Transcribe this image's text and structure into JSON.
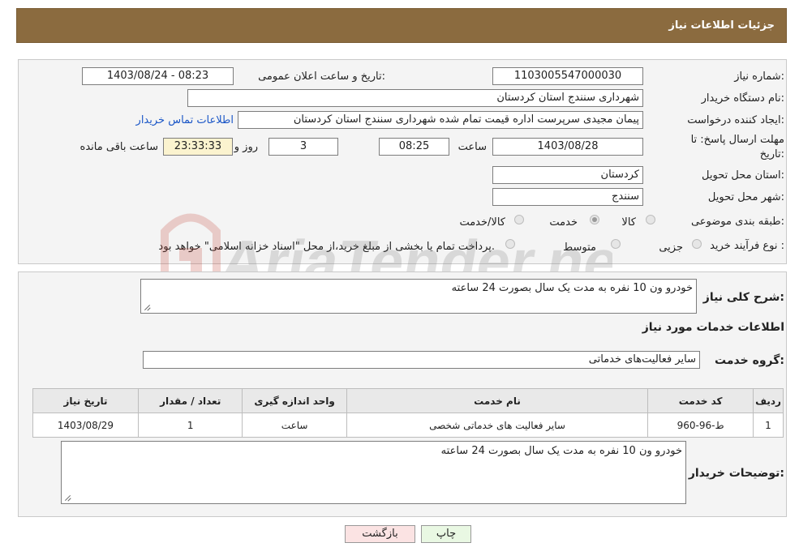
{
  "header": {
    "title": "جزئیات اطلاعات نیاز"
  },
  "form": {
    "need_number_label": "شماره نیاز:",
    "need_number": "1103005547000030",
    "announce_label": "تاریخ و ساعت اعلان عمومی:",
    "announce_value": "1403/08/24 - 08:23",
    "buyer_org_label": "نام دستگاه خریدار:",
    "buyer_org": "شهرداری سنندج استان کردستان",
    "creator_label": "ایجاد کننده درخواست:",
    "creator": "پیمان مجیدی سرپرست اداره قیمت تمام شده شهرداری سنندج استان کردستان",
    "contact_link": "اطلاعات تماس خریدار",
    "deadline_label_1": "مهلت ارسال پاسخ: تا",
    "deadline_label_2": "تاریخ:",
    "deadline_date": "1403/08/28",
    "time_label": "ساعت",
    "deadline_time": "08:25",
    "days": "3",
    "days_label": "روز و",
    "remaining": "23:33:33",
    "remaining_label": "ساعت باقی مانده",
    "province_label": "استان محل تحویل:",
    "province": "کردستان",
    "city_label": "شهر محل تحویل:",
    "city": "سنندج",
    "category_label": "طبقه بندی موضوعی:",
    "category_options": [
      "کالا",
      "خدمت",
      "کالا/خدمت"
    ],
    "category_selected": "خدمت",
    "process_label": "نوع فرآیند خرید :",
    "process_options": [
      "جزیی",
      "متوسط",
      ""
    ],
    "process_note": "پرداخت تمام یا بخشی از مبلغ خرید،از محل \"اسناد خزانه اسلامی\" خواهد بود."
  },
  "details": {
    "summary_label": "شرح کلی نیاز:",
    "summary": "خودرو ون 10 نفره به مدت یک سال بصورت 24 ساعته",
    "services_title": "اطلاعات خدمات مورد نیاز",
    "service_group_label": "گروه خدمت:",
    "service_group": "سایر فعالیت‌های خدماتی",
    "table": {
      "headers": [
        "ردیف",
        "کد خدمت",
        "نام خدمت",
        "واحد اندازه گیری",
        "تعداد / مقدار",
        "تاریخ نیاز"
      ],
      "rows": [
        [
          "1",
          "ط-96-960",
          "سایر فعالیت های خدماتی شخصی",
          "ساعت",
          "1",
          "1403/08/29"
        ]
      ]
    },
    "buyer_notes_label": "توضیحات خریدار:",
    "buyer_notes": "خودرو ون 10 نفره به مدت یک سال بصورت 24 ساعته"
  },
  "buttons": {
    "print": "چاپ",
    "back": "بازگشت"
  },
  "watermark": "AriaTender.neT",
  "colors": {
    "header_bg": "#8b6b3f",
    "link": "#1a56c7",
    "print_bg": "#e9f8e3",
    "back_bg": "#fbe3e3"
  }
}
